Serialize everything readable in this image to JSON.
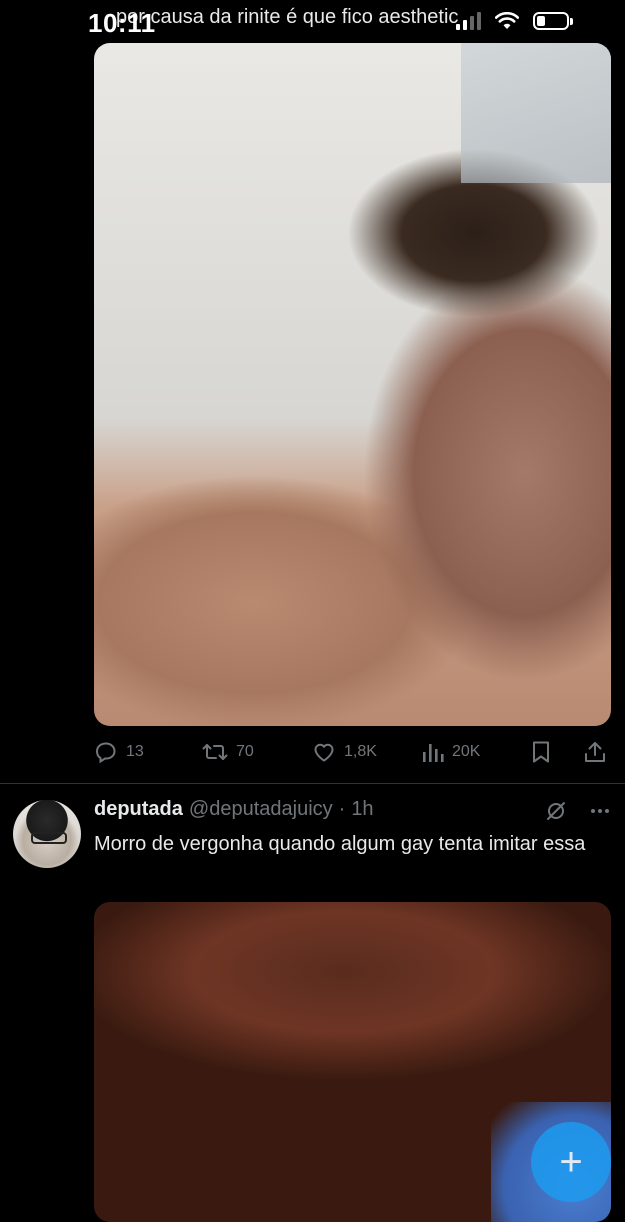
{
  "status_bar": {
    "time": "10:11",
    "battery_level": 0.3
  },
  "tweet1": {
    "text_fragment": "por causa da rinite é que fico aesthetic",
    "media_description": "",
    "actions": {
      "replies": "13",
      "reposts": "70",
      "likes": "1,8K",
      "views": "20K"
    }
  },
  "tweet2": {
    "display_name": "deputada",
    "handle": "@deputadajuicy",
    "separator": "·",
    "time": "1h",
    "text": "Morro de vergonha quando algum gay tenta imitar essa"
  },
  "fab": {
    "label": "+"
  },
  "colors": {
    "background": "#000000",
    "text": "#e7e9ea",
    "muted": "#71767b",
    "accent": "#1d9bf0",
    "divider": "#2f3336"
  }
}
